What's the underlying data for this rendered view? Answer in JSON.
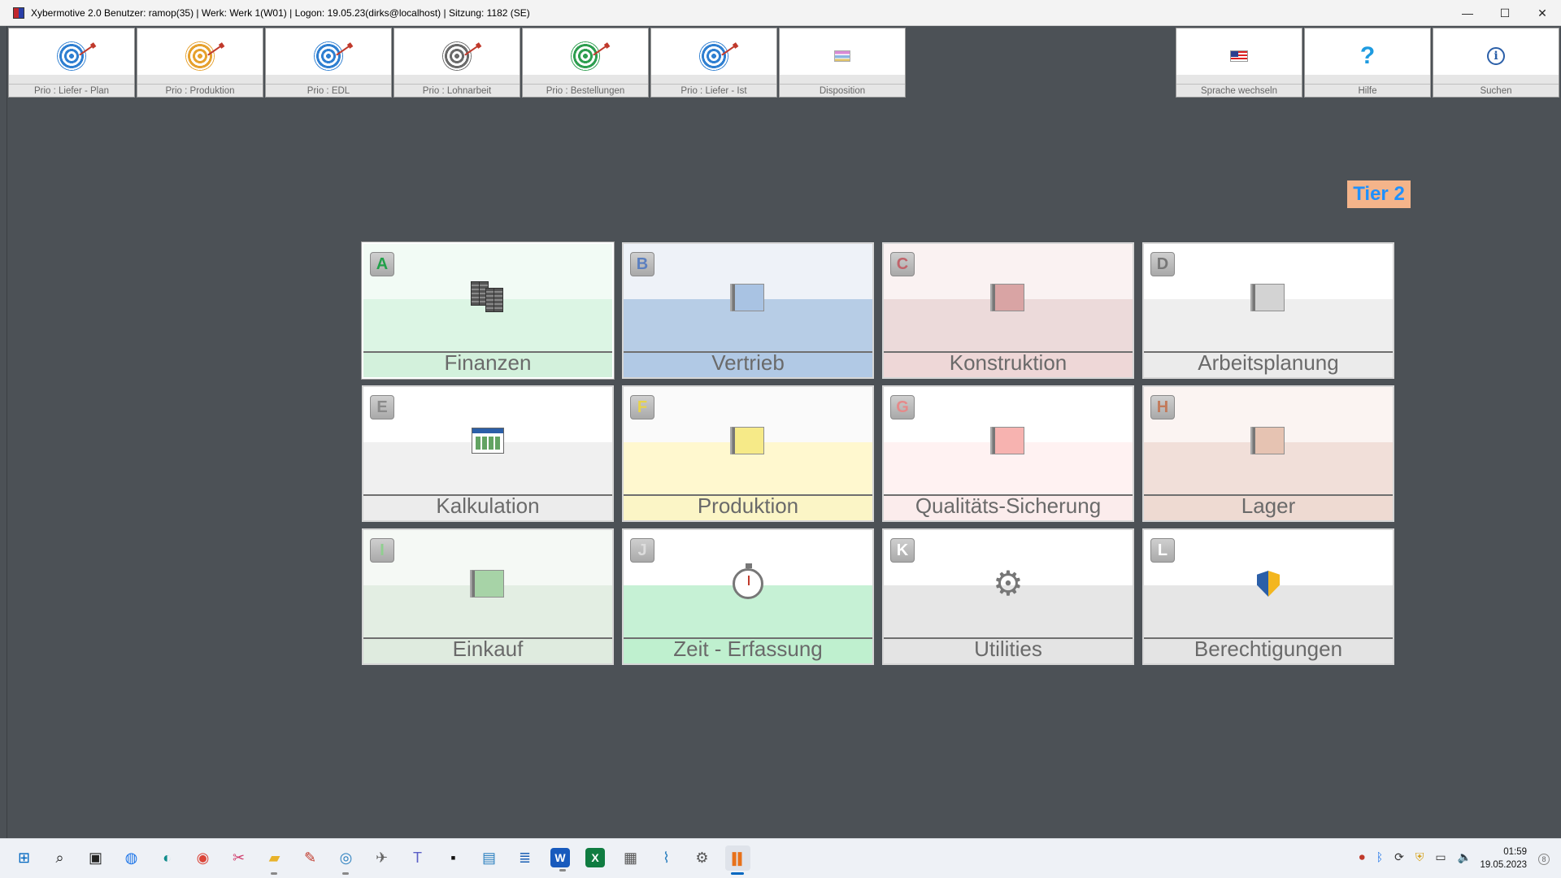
{
  "window": {
    "title": "Xybermotive 2.0  Benutzer: ramop(35) | Werk: Werk 1(W01) | Logon: 19.05.23(dirks@localhost) | Sitzung: 1182 (SE)",
    "minimize": "—",
    "maximize": "☐",
    "close": "✕"
  },
  "toolbar": {
    "left": [
      {
        "label": "Prio :  Liefer - Plan",
        "icon": "target-blue-icon",
        "color": "#2f7fd1"
      },
      {
        "label": "Prio : Produktion",
        "icon": "target-orange-icon",
        "color": "#e6a12e"
      },
      {
        "label": "Prio :  EDL",
        "icon": "target-blue-icon",
        "color": "#2f7fd1"
      },
      {
        "label": "Prio : Lohnarbeit",
        "icon": "target-gray-icon",
        "color": "#6a6a6a"
      },
      {
        "label": "Prio : Bestellungen",
        "icon": "target-green-icon",
        "color": "#2e9e4f"
      },
      {
        "label": "Prio :  Liefer - Ist",
        "icon": "target-blue-icon",
        "color": "#2f7fd1"
      },
      {
        "label": "Disposition",
        "icon": "disposition-icon",
        "color": "#b36ad1"
      }
    ],
    "right": [
      {
        "label": "Sprache wechseln",
        "icon": "us-flag-icon"
      },
      {
        "label": "Hilfe",
        "icon": "help-icon",
        "glyph": "?"
      },
      {
        "label": "Suchen",
        "icon": "info-icon",
        "glyph": "i"
      }
    ]
  },
  "tier": "Tier 2",
  "modules": [
    {
      "letter": "A",
      "label": "Finanzen",
      "letter_color": "#22a04a",
      "top": "#f2fbf5",
      "mid": "#dcf5e4",
      "bottom": "#d3f1dc",
      "icon": "finance-binders-icon"
    },
    {
      "letter": "B",
      "label": "Vertrieb",
      "letter_color": "#5b7fbf",
      "top": "#eef2f8",
      "mid": "#b7cde6",
      "bottom": "#b1c9e5",
      "icon": "blue-square-icon",
      "sq": "#a9c3e3"
    },
    {
      "letter": "C",
      "label": "Konstruktion",
      "letter_color": "#c0636a",
      "top": "#faf2f2",
      "mid": "#ecdada",
      "bottom": "#eed7d7",
      "icon": "red-square-icon",
      "sq": "#d9a4a4"
    },
    {
      "letter": "D",
      "label": "Arbeitsplanung",
      "letter_color": "#777777",
      "top": "#ffffff",
      "mid": "#eeeeee",
      "bottom": "#ebebeb",
      "icon": "gray-square-icon",
      "sq": "#d3d3d3"
    },
    {
      "letter": "E",
      "label": "Kalkulation",
      "letter_color": "#8a8a8a",
      "top": "#ffffff",
      "mid": "#f0f0f0",
      "bottom": "#ececec",
      "icon": "calculation-window-icon"
    },
    {
      "letter": "F",
      "label": "Produktion",
      "letter_color": "#e8d34a",
      "top": "#fafafa",
      "mid": "#fff8cf",
      "bottom": "#fbf5c6",
      "icon": "yellow-square-icon",
      "sq": "#f6ea88"
    },
    {
      "letter": "G",
      "label": "Qualitäts-Sicherung",
      "letter_color": "#e58a8a",
      "top": "#ffffff",
      "mid": "#fff2f2",
      "bottom": "#fbecec",
      "icon": "pink-square-icon",
      "sq": "#f7b3b0"
    },
    {
      "letter": "H",
      "label": "Lager",
      "letter_color": "#c27a5a",
      "top": "#fbf4f2",
      "mid": "#f1dfd9",
      "bottom": "#eedad2",
      "icon": "peach-square-icon",
      "sq": "#e6c3b2"
    },
    {
      "letter": "I",
      "label": "Einkauf",
      "letter_color": "#8fcf8f",
      "top": "#f5f9f5",
      "mid": "#e3eee3",
      "bottom": "#dfebdf",
      "icon": "green-square-icon",
      "sq": "#a7d3a7"
    },
    {
      "letter": "J",
      "label": "Zeit - Erfassung",
      "letter_color": "#dddddd",
      "top": "#ffffff",
      "mid": "#c6f1d5",
      "bottom": "#bff0cf",
      "icon": "stopwatch-icon"
    },
    {
      "letter": "K",
      "label": "Utilities",
      "letter_color": "#ffffff",
      "top": "#ffffff",
      "mid": "#e6e6e6",
      "bottom": "#e4e4e4",
      "icon": "gears-icon"
    },
    {
      "letter": "L",
      "label": "Berechtigungen",
      "letter_color": "#ffffff",
      "top": "#ffffff",
      "mid": "#e6e6e6",
      "bottom": "#e4e4e4",
      "icon": "shield-icon"
    }
  ],
  "taskbar": {
    "apps": [
      {
        "icon": "windows-start-icon",
        "glyph": "⊞",
        "color": "#0067c0"
      },
      {
        "icon": "search-icon",
        "glyph": "⌕",
        "color": "#222"
      },
      {
        "icon": "task-view-icon",
        "glyph": "▣",
        "color": "#222"
      },
      {
        "icon": "support-icon",
        "glyph": "◍",
        "color": "#1a73e8"
      },
      {
        "icon": "edge-icon",
        "glyph": "◐",
        "color": "#0f8c8c"
      },
      {
        "icon": "chrome-icon",
        "glyph": "◉",
        "color": "#db4437"
      },
      {
        "icon": "snipping-icon",
        "glyph": "✂",
        "color": "#d03a6a"
      },
      {
        "icon": "explorer-icon",
        "glyph": "▰",
        "color": "#e8b22a",
        "running": true
      },
      {
        "icon": "app-icon",
        "glyph": "✎",
        "color": "#c0392b"
      },
      {
        "icon": "globe-icon",
        "glyph": "◎",
        "color": "#2a7fbf",
        "running": true
      },
      {
        "icon": "plane-icon",
        "glyph": "✈",
        "color": "#666"
      },
      {
        "icon": "teams-icon",
        "glyph": "T",
        "color": "#5b5fc7"
      },
      {
        "icon": "terminal-icon",
        "glyph": "▪",
        "color": "#111"
      },
      {
        "icon": "remote-desktop-icon",
        "glyph": "▤",
        "color": "#2a7fbf"
      },
      {
        "icon": "notepad-icon",
        "glyph": "≣",
        "color": "#1a5fb4"
      },
      {
        "icon": "word-icon",
        "glyph": "W",
        "color": "#185abd",
        "running": true
      },
      {
        "icon": "excel-icon",
        "glyph": "X",
        "color": "#107c41"
      },
      {
        "icon": "calculator-icon",
        "glyph": "▦",
        "color": "#555"
      },
      {
        "icon": "monitor-icon",
        "glyph": "⌇",
        "color": "#2a7fbf"
      },
      {
        "icon": "settings-icon",
        "glyph": "⚙",
        "color": "#555"
      },
      {
        "icon": "xybermotive-icon",
        "glyph": "▌▌",
        "color": "#e8711a",
        "active": true
      }
    ],
    "tray": [
      {
        "icon": "record-icon",
        "glyph": "⏺",
        "color": "#c0392b"
      },
      {
        "icon": "bluetooth-icon",
        "glyph": "ᛒ",
        "color": "#1a73e8"
      },
      {
        "icon": "sync-icon",
        "glyph": "⟳",
        "color": "#333"
      },
      {
        "icon": "security-icon",
        "glyph": "⛨",
        "color": "#d4a017"
      },
      {
        "icon": "network-icon",
        "glyph": "▭",
        "color": "#333"
      },
      {
        "icon": "volume-icon",
        "glyph": "🔈",
        "color": "#333"
      }
    ],
    "time": "01:59",
    "date": "19.05.2023",
    "notifications": "8"
  }
}
